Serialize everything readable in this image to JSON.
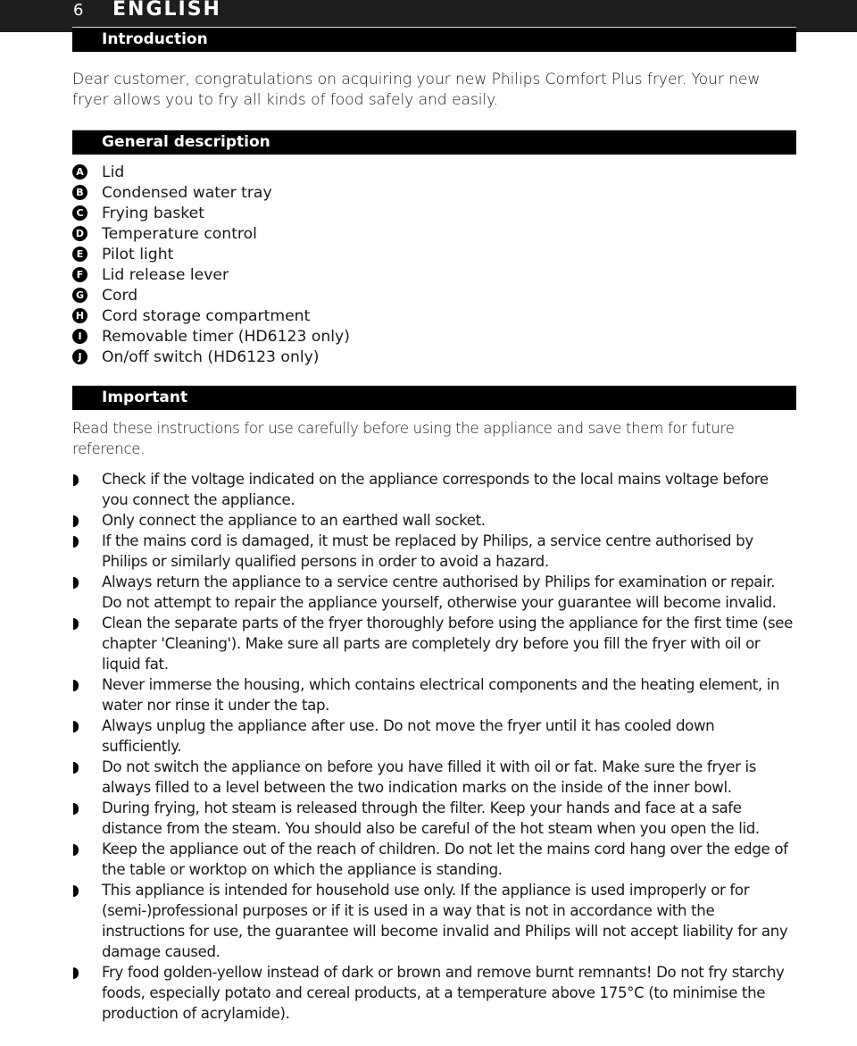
{
  "header": {
    "page_number": "6",
    "language": "ENGLISH"
  },
  "introduction": {
    "title": "Introduction",
    "text": "Dear customer, congratulations on acquiring your new Philips Comfort Plus fryer. Your new fryer allows you to fry all kinds of food safely and easily."
  },
  "general_description": {
    "title": "General description",
    "parts": [
      {
        "letter": "A",
        "label": "Lid"
      },
      {
        "letter": "B",
        "label": "Condensed water tray"
      },
      {
        "letter": "C",
        "label": "Frying basket"
      },
      {
        "letter": "D",
        "label": "Temperature control"
      },
      {
        "letter": "E",
        "label": "Pilot light"
      },
      {
        "letter": "F",
        "label": "Lid release lever"
      },
      {
        "letter": "G",
        "label": "Cord"
      },
      {
        "letter": "H",
        "label": "Cord storage compartment"
      },
      {
        "letter": "I",
        "label": "Removable timer (HD6123 only)"
      },
      {
        "letter": "J",
        "label": "On/off switch (HD6123 only)"
      }
    ]
  },
  "important": {
    "title": "Important",
    "intro": "Read these instructions for use carefully before using the appliance and save them for future reference.",
    "items": [
      "Check if the voltage indicated on the appliance corresponds to the local mains voltage before you connect the appliance.",
      "Only connect the appliance to an earthed wall socket.",
      "If the mains cord is damaged, it must be replaced by Philips, a service centre authorised by Philips or similarly qualified persons in order to avoid a hazard.",
      "Always return the appliance to a service centre authorised by Philips for examination or repair. Do not attempt to repair the appliance yourself, otherwise your guarantee will become invalid.",
      "Clean the separate parts of the fryer thoroughly before using the appliance for the first time (see chapter 'Cleaning'). Make sure all parts are completely dry before you fill the fryer with oil or liquid fat.",
      "Never immerse the housing, which contains electrical components and the heating element, in water nor rinse it under the tap.",
      "Always unplug the appliance after use. Do not move the fryer until it has cooled down sufficiently.",
      "Do not switch the appliance on before you have filled it with oil or fat. Make sure the fryer is always filled to a level between the two indication marks on the inside of the inner bowl.",
      "During frying, hot steam is released through the filter. Keep your hands and face at a safe distance from the steam. You should also be careful of the hot steam when you open the lid.",
      "Keep the appliance out of the reach of children. Do not let the mains cord hang over the edge of the table or worktop on which the appliance is standing.",
      "This appliance is intended for household use only. If the appliance is used improperly or for (semi-)professional purposes or if it is used in a way that is not in accordance with the instructions for use, the guarantee will become invalid and Philips will not accept liability for any damage caused.",
      "Fry food golden-yellow instead of dark or brown and remove burnt remnants! Do not fry starchy foods, especially potato and cereal products, at a temperature above 175°C (to minimise the production of acrylamide)."
    ]
  }
}
